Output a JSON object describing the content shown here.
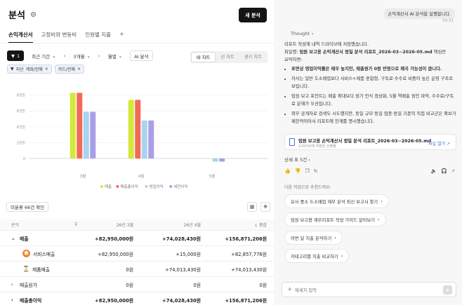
{
  "header": {
    "title": "분석",
    "new_button": "새 분석"
  },
  "tabs": [
    {
      "label": "손익계산서",
      "active": true
    },
    {
      "label": "고정비와 변동비",
      "active": false
    },
    {
      "label": "인원별 지출",
      "active": false
    },
    {
      "label": "+",
      "active": false
    }
  ],
  "toolbar": {
    "filter_count": "1",
    "period_label": "최근 기간",
    "range_label": "3개월",
    "unit_label": "월별",
    "ai_label": "AI 분석",
    "views": [
      {
        "label": "바 차트",
        "active": true
      },
      {
        "label": "선 차트",
        "active": false
      },
      {
        "label": "생키 차트",
        "active": false
      }
    ]
  },
  "filters": [
    {
      "label": "지산",
      "value": "계좌/전체"
    },
    {
      "label": "",
      "value": "카드/전체"
    }
  ],
  "chart_data": {
    "type": "bar",
    "categories": [
      "3월",
      "4월",
      "5월"
    ],
    "series": [
      {
        "name": "매출",
        "color": "#d4e83a",
        "values": [
          82950000,
          74028430,
          0
        ]
      },
      {
        "name": "매출총이익",
        "color": "#f26a55",
        "values": [
          82950000,
          74028430,
          0
        ]
      },
      {
        "name": "영업이익",
        "color": "#a9d3f0",
        "values": [
          59000000,
          48000000,
          -4000000
        ]
      },
      {
        "name": "세전이익",
        "color": "#a99fe6",
        "values": [
          59000000,
          48000000,
          -4000000
        ]
      }
    ],
    "y_ticks": [
      "8천만",
      "6천만",
      "4천만",
      "2천만",
      "0"
    ],
    "ylim": [
      -8000000,
      85000000
    ],
    "legend": "bottom",
    "grid": true
  },
  "table": {
    "unclassified_label": "미분류 66건 확인",
    "headers": {
      "name": "손익",
      "c1": "26년 3월",
      "c2": "26년 4월",
      "c3": "↓ 총합"
    },
    "rows": [
      {
        "name": "매출",
        "c1": "+82,950,000원",
        "c2": "+74,028,430원",
        "c3": "+156,871,206원",
        "bold": true,
        "chevron": "⌄",
        "icon": ""
      },
      {
        "name": "서비스매출",
        "c1": "+82,950,000원",
        "c2": "+15,000원",
        "c3": "+82,857,776원",
        "bold": false,
        "chevron": "",
        "icon": "avatar"
      },
      {
        "name": "제품매출",
        "c1": "0원",
        "c2": "+74,013,430원",
        "c3": "+74,013,430원",
        "bold": false,
        "chevron": "",
        "icon": "hourglass"
      },
      {
        "name": "매출원가",
        "c1": "0원",
        "c2": "0원",
        "c3": "0원",
        "bold": false,
        "chevron": "›",
        "icon": ""
      },
      {
        "name": "매출총이익",
        "c1": "+82,950,000원",
        "c2": "+74,028,430원",
        "c3": "+156,871,206원",
        "bold": true,
        "chevron": "›",
        "icon": ""
      }
    ]
  },
  "chat": {
    "user_message": "손익계산서 AI 분석을 실행합니다.",
    "user_time": "09:31",
    "thought_label": "Thought",
    "intro": "리포트 작성해 내역 드라이브에 저장했습니다.",
    "file_line_prefix": "파일명: ",
    "file_line_name": "임원 보고용 손익계산서 정밀 분석 리포트_2026-03~2026-05.md",
    "file_line_suffix": " 핵심만",
    "summary_label": "요약하면:",
    "bullets": [
      {
        "bold": "표면상 영업이익률은 매우 높지만, 매출원가 0원 반영으로 왜곡 가능성이 큽니다.",
        "text": ""
      },
      {
        "bold": "",
        "text": "자사는 일반 도소매업보다 서비스+제품 혼합형, 구독료·수수료 비중이 높은 운영 구조로 보입니다."
      },
      {
        "bold": "",
        "text": "임원 보고 포인트는 매출 확대보다 원가 인식 정상화, 5월 역매출 원인 파악, 수수료/구독료 분해가 우선입니다."
      },
      {
        "bold": "",
        "text": "외부 공개자료 검색도 시도했지만, 동일 규모·동일 업종·동일 기준의 직접 비교군은 확보가 제한적이어서 리포트에 한계를 명시했습니다."
      }
    ],
    "file_card": {
      "name": "임원 보고용 손익계산서 정밀 분석 리포트_2026-03~2026-05.md",
      "sub": "드라이브에 저장된 산출물",
      "open": "파일 열기 ↗"
    },
    "more_label": "상세 표 5건 ›",
    "suggest_label": "다음 작업으로 추천드려요:",
    "suggestions": [
      "유사 중소 도소매업 재무 분석 최신 보고서 찾기",
      "임원 보고용 재무리포트 작성 가이드 알아보기",
      "이번 달 지출 분석하기",
      "카테고리별 지출 비교하기"
    ],
    "input_placeholder": "메세지 입력"
  }
}
